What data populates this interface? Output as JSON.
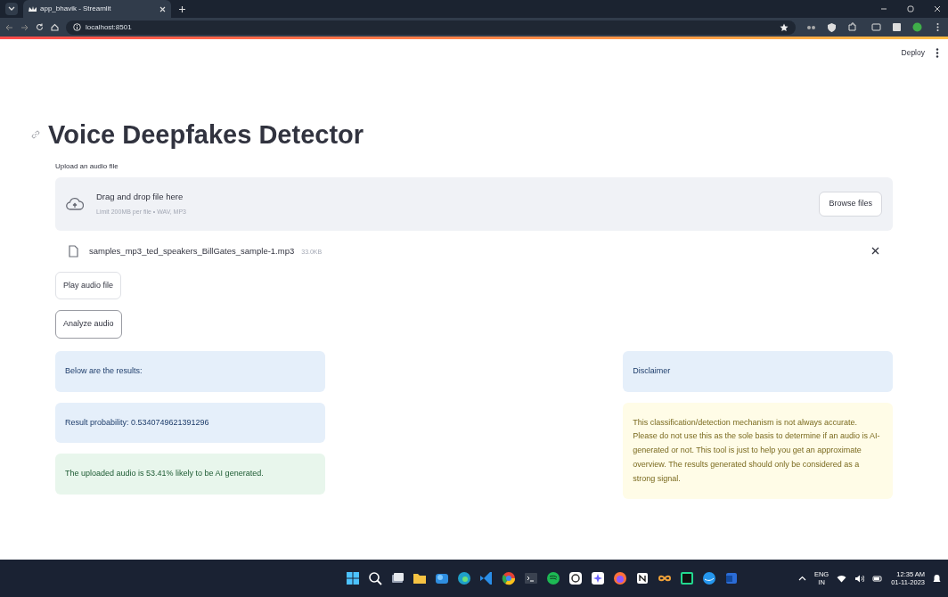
{
  "browser": {
    "tab_title": "app_bhavik - Streamlit",
    "url": "localhost:8501"
  },
  "header": {
    "deploy": "Deploy"
  },
  "title": "Voice Deepfakes Detector",
  "uploader": {
    "label": "Upload an audio file",
    "drop_text": "Drag and drop file here",
    "limit": "Limit 200MB per file • WAV, MP3",
    "browse": "Browse files"
  },
  "file": {
    "name": "samples_mp3_ted_speakers_BillGates_sample-1.mp3",
    "size": "33.0KB"
  },
  "buttons": [
    {
      "label": "Play audio file",
      "focused": false
    },
    {
      "label": "Analyze audio",
      "focused": true
    }
  ],
  "results": [
    {
      "kind": "info",
      "text": "Below are the results:"
    },
    {
      "kind": "info",
      "text": "Result probability: 0.5340749621391296"
    },
    {
      "kind": "success",
      "text": "The uploaded audio is 53.41% likely to be AI generated."
    }
  ],
  "disclaimer": [
    {
      "kind": "info",
      "text": "Disclaimer"
    },
    {
      "kind": "warning",
      "text": "This classification/detection mechanism is not always accurate. Please do not use this as the sole basis to determine if an audio is AI-generated or not. This tool is just to help you get an approximate overview. The results generated should only be considered as a strong signal."
    }
  ],
  "taskbar": {
    "language": "ENG",
    "region": "IN",
    "time": "12:35 AM",
    "date": "01-11-2023"
  }
}
